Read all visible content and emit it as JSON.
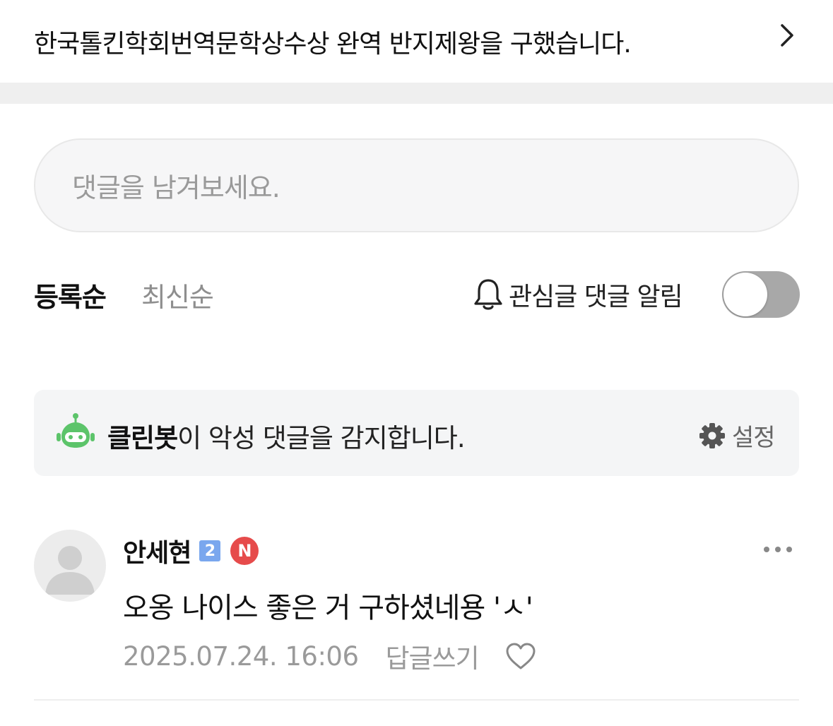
{
  "related": {
    "title": "한국톨킨학회번역문학상수상 완역 반지제왕을 구했습니다."
  },
  "comment_input": {
    "placeholder": "댓글을 남겨보세요."
  },
  "sort": {
    "options": [
      "등록순",
      "최신순"
    ],
    "selected": "등록순"
  },
  "alarm": {
    "label": "관심글 댓글 알림",
    "enabled": false
  },
  "cleanbot": {
    "name": "클린봇",
    "message": "이 악성 댓글을 감지합니다.",
    "settings_label": "설정",
    "color": "#5cc46a"
  },
  "comments": [
    {
      "author": "안세현",
      "level_badge": "2",
      "n_badge": "N",
      "text": "오옹 나이스 좋은 거 구하셨네용 'ㅅ'",
      "date": "2025.07.24. 16:06",
      "reply_label": "답글쓰기"
    }
  ],
  "icons": [
    "chevron-right-icon",
    "bell-icon",
    "robot-icon",
    "gear-icon",
    "avatar-placeholder-icon",
    "more-icon",
    "heart-icon"
  ]
}
